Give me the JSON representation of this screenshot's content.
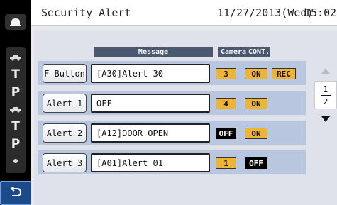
{
  "header": {
    "title": "Security Alert",
    "date": "11/27/2013(Wed)",
    "time": "15:02"
  },
  "columns": {
    "message": "Message",
    "camera": "Camera",
    "cont": "CONT."
  },
  "rows": [
    {
      "button": "F Button",
      "message": "[A30]Alert 30",
      "camera": "3",
      "cont": "ON",
      "extra": "REC"
    },
    {
      "button": "Alert 1",
      "message": "OFF",
      "camera": "4",
      "cont": "ON"
    },
    {
      "button": "Alert 2",
      "message": "[A12]DOOR OPEN",
      "camera": "OFF",
      "cont": "ON"
    },
    {
      "button": "Alert 3",
      "message": "[A01]Alert 01",
      "camera": "1",
      "cont": "OFF"
    }
  ],
  "pagination": {
    "current": "1",
    "total": "2"
  },
  "sidebar": {
    "items": [
      "T",
      "P",
      "T",
      "P"
    ]
  },
  "colors": {
    "accent_orange": "#f0b434",
    "row_blue": "#b8c6e0",
    "header_dark": "#4a5870",
    "back_button_blue": "#1d4a8a"
  },
  "icons": {
    "top": "camera-icon",
    "car_1": "car-icon",
    "car_2": "car-icon",
    "dot": "dot-icon",
    "back": "return-arrow-icon",
    "scroll_up": "triangle-up-icon",
    "scroll_down": "triangle-down-icon"
  }
}
